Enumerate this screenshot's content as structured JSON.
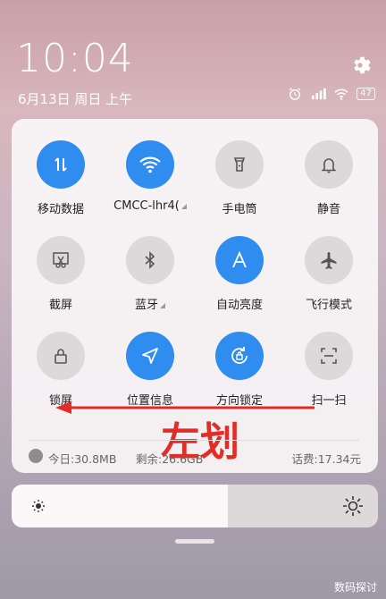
{
  "status": {
    "time": "10:04",
    "date": "6月13日 周日 上午",
    "battery": "47"
  },
  "tiles": [
    {
      "label": "移动数据",
      "icon": "mobile-data-icon",
      "state": "on"
    },
    {
      "label": "CMCC-lhr4(",
      "icon": "wifi-icon",
      "state": "on"
    },
    {
      "label": "手电筒",
      "icon": "flashlight-icon",
      "state": "off"
    },
    {
      "label": "静音",
      "icon": "bell-icon",
      "state": "off"
    },
    {
      "label": "截屏",
      "icon": "screenshot-icon",
      "state": "off"
    },
    {
      "label": "蓝牙",
      "icon": "bluetooth-icon",
      "state": "off"
    },
    {
      "label": "自动亮度",
      "icon": "auto-brightness-icon",
      "state": "on"
    },
    {
      "label": "飞行模式",
      "icon": "airplane-icon",
      "state": "off"
    },
    {
      "label": "锁屏",
      "icon": "lock-icon",
      "state": "off"
    },
    {
      "label": "位置信息",
      "icon": "location-icon",
      "state": "on"
    },
    {
      "label": "方向锁定",
      "icon": "rotation-lock-icon",
      "state": "on"
    },
    {
      "label": "扫一扫",
      "icon": "scan-icon",
      "state": "off"
    }
  ],
  "annotation": {
    "swipe_text": "左划"
  },
  "data_usage": {
    "today": "今日:30.8MB",
    "remaining": "剩余:26.6GB",
    "bill": "话费:17.34元"
  },
  "brightness": {
    "level": 0.59
  },
  "colors": {
    "accent": "#2f8df0",
    "annotation": "#e12d26"
  },
  "watermark": "数码探讨"
}
